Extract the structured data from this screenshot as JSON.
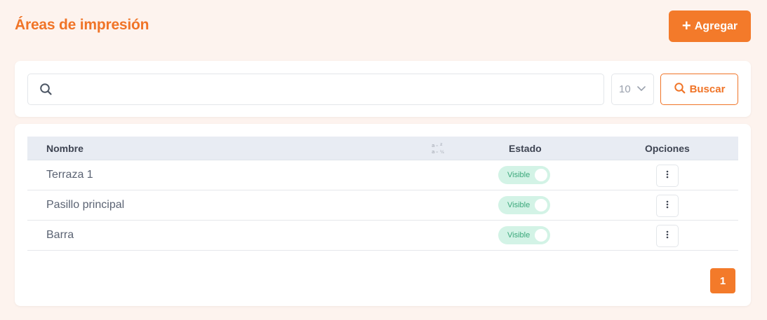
{
  "header": {
    "title": "Áreas de impresión",
    "add_label": "Agregar"
  },
  "search": {
    "value": "",
    "placeholder": "",
    "page_size": "10",
    "button_label": "Buscar"
  },
  "table": {
    "columns": [
      "Nombre",
      "Estado",
      "Opciones"
    ],
    "rows": [
      {
        "name": "Terraza 1",
        "status": "Visible"
      },
      {
        "name": "Pasillo principal",
        "status": "Visible"
      },
      {
        "name": "Barra",
        "status": "Visible"
      }
    ]
  },
  "pagination": {
    "current_page": "1"
  },
  "colors": {
    "accent": "#f37a2a",
    "background": "#fdf3ee",
    "visible_badge": "#d3f3e6",
    "visible_text": "#3aa87a"
  },
  "icons": {
    "add": "plus-icon",
    "search": "search-icon",
    "page_size_caret": "chevron-down-icon",
    "sort": "sort-alpha-icon",
    "row_options": "kebab-menu-icon"
  }
}
